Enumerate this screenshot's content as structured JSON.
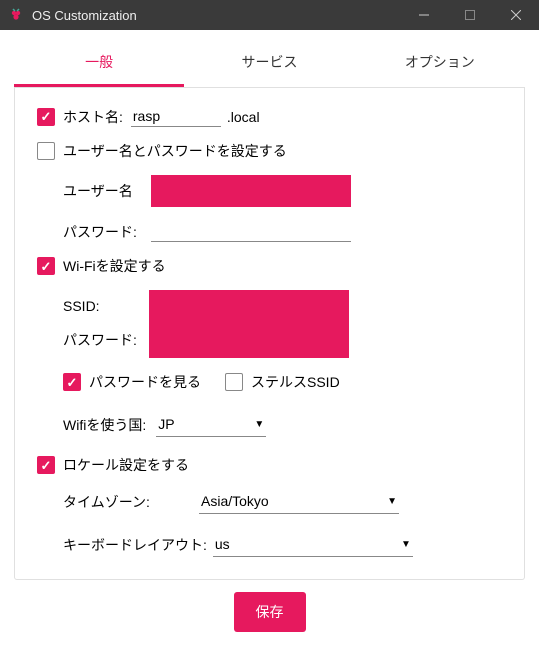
{
  "window": {
    "title": "OS Customization"
  },
  "tabs": {
    "general": "一般",
    "services": "サービス",
    "options": "オプション"
  },
  "form": {
    "hostname_label": "ホスト名:",
    "hostname_value": "rasp",
    "hostname_suffix": ".local",
    "userpass_label": "ユーザー名とパスワードを設定する",
    "username_label": "ユーザー名",
    "password_label": "パスワード:",
    "wifi_label": "Wi-Fiを設定する",
    "ssid_label": "SSID:",
    "wifi_password_label": "パスワード:",
    "show_password_label": "パスワードを見る",
    "hidden_ssid_label": "ステルスSSID",
    "wifi_country_label": "Wifiを使う国:",
    "wifi_country_value": "JP",
    "locale_label": "ロケール設定をする",
    "timezone_label": "タイムゾーン:",
    "timezone_value": "Asia/Tokyo",
    "keyboard_label": "キーボードレイアウト:",
    "keyboard_value": "us",
    "save_label": "保存"
  },
  "checked": {
    "hostname": true,
    "userpass": false,
    "wifi": true,
    "show_password": true,
    "hidden_ssid": false,
    "locale": true
  }
}
